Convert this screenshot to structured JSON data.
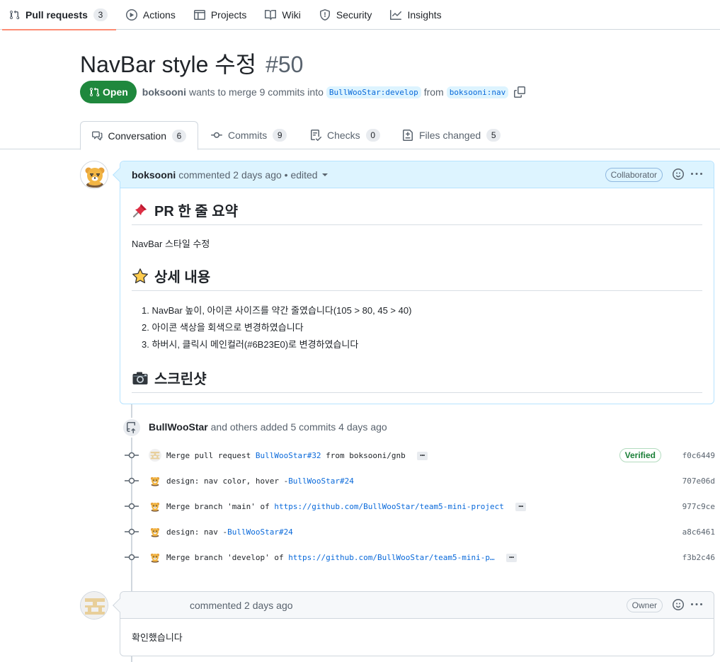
{
  "repo_nav": {
    "tabs": [
      {
        "label": "Pull requests",
        "count": "3"
      },
      {
        "label": "Actions"
      },
      {
        "label": "Projects"
      },
      {
        "label": "Wiki"
      },
      {
        "label": "Security"
      },
      {
        "label": "Insights"
      }
    ]
  },
  "pr": {
    "title": "NavBar style 수정",
    "number": "#50",
    "state": "Open",
    "author": "boksooni",
    "merge_text": "wants to merge 9 commits into",
    "base_branch": "BullWooStar:develop",
    "from_text": "from",
    "head_branch": "boksooni:nav"
  },
  "pr_tabs": [
    {
      "label": "Conversation",
      "count": "6"
    },
    {
      "label": "Commits",
      "count": "9"
    },
    {
      "label": "Checks",
      "count": "0"
    },
    {
      "label": "Files changed",
      "count": "5"
    }
  ],
  "comment1": {
    "author": "boksooni",
    "meta": "commented 2 days ago • edited",
    "role": "Collaborator",
    "h_summary": "PR 한 줄 요약",
    "summary": "NavBar 스타일 수정",
    "h_details": "상세 내용",
    "details": [
      "1. NavBar 높이, 아이콘 사이즈를 약간 줄였습니다(105 > 80, 45 > 40)",
      "2. 아이콘 색상을 회색으로 변경하였습니다",
      "3. 하버시, 클릭시 메인컬러(#6B23E0)로 변경하였습니다"
    ],
    "h_screenshot": "스크린샷"
  },
  "commits_event": {
    "author": "BullWooStar",
    "text": "and others added 5 commits 4 days ago",
    "commits": [
      {
        "prefix": "Merge pull request ",
        "link": "BullWooStar#32",
        "suffix": " from boksooni/gnb",
        "ellipsis": "…",
        "verified": "Verified",
        "sha": "f0c6449"
      },
      {
        "prefix": "design: nav color, hover -",
        "link": "BullWooStar#24",
        "suffix": "",
        "sha": "707e06d"
      },
      {
        "prefix": "Merge branch 'main' of ",
        "link": "https://github.com/BullWooStar/team5-mini-project",
        "suffix": "",
        "ellipsis": "…",
        "sha": "977c9ce"
      },
      {
        "prefix": "design: nav -",
        "link": "BullWooStar#24",
        "suffix": "",
        "sha": "a8c6461"
      },
      {
        "prefix": "Merge branch 'develop' of ",
        "link": "https://github.com/BullWooStar/team5-mini-p…",
        "suffix": "",
        "ellipsis": "…",
        "sha": "f3b2c46"
      }
    ]
  },
  "comment2": {
    "meta": "commented 2 days ago",
    "role": "Owner",
    "body": "확인했습니다"
  },
  "colors": {
    "accent": "#0969da",
    "open_green": "#1f883d",
    "tab_underline": "#fd8c73"
  }
}
